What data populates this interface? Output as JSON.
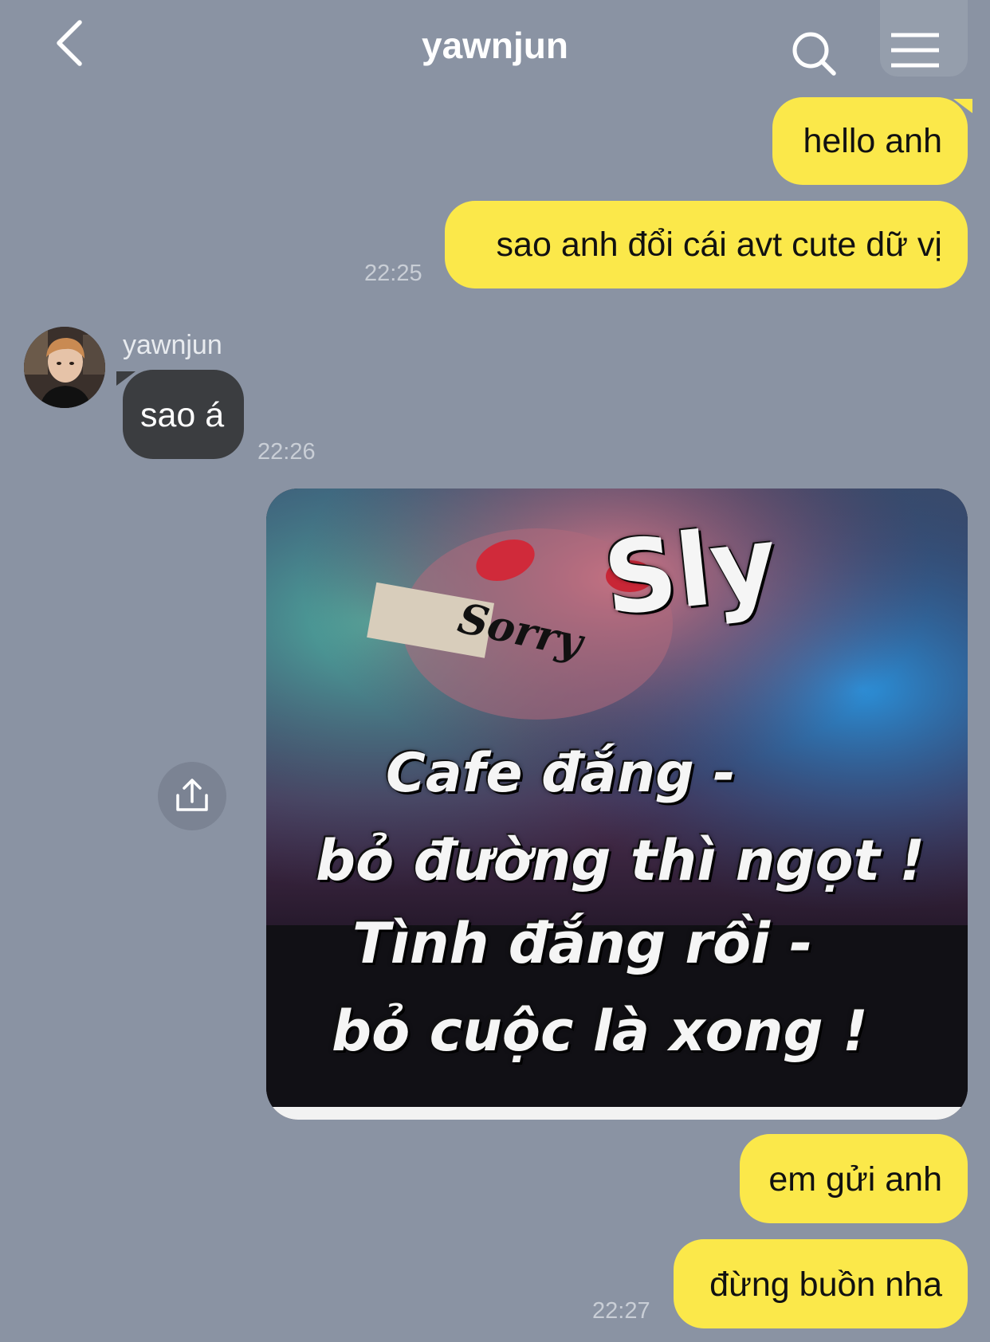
{
  "header": {
    "title": "yawnjun",
    "back_icon": "chevron-left-icon",
    "search_icon": "search-icon",
    "menu_icon": "hamburger-menu-icon"
  },
  "messages": [
    {
      "from": "me",
      "text": "hello anh"
    },
    {
      "from": "me",
      "text": "sao anh đổi cái avt cute dữ vị",
      "time": "22:25"
    },
    {
      "from": "them",
      "sender": "yawnjun",
      "text": "sao á",
      "time": "22:26"
    },
    {
      "from": "me",
      "type": "image",
      "image_text": {
        "brand": "Sly",
        "card": "Sorry",
        "lines": [
          "Cafe đắng -",
          "bỏ đường thì ngọt !",
          "Tình đắng rồi -",
          "bỏ cuộc là xong !"
        ]
      }
    },
    {
      "from": "me",
      "text": "em gửi anh"
    },
    {
      "from": "me",
      "text": "đừng buồn nha",
      "time": "22:27"
    }
  ],
  "colors": {
    "background": "#8a93a3",
    "my_bubble": "#fbe84a",
    "their_bubble": "#3b3d40",
    "title": "#ffffff"
  }
}
